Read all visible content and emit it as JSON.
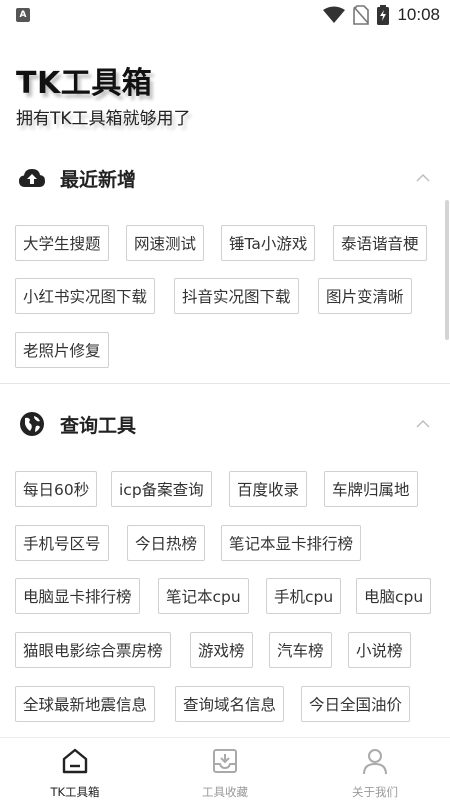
{
  "status_bar": {
    "notification_letter": "A",
    "time": "10:08"
  },
  "header": {
    "title": "TK工具箱",
    "subtitle": "拥有TK工具箱就够用了"
  },
  "sections": {
    "recent": {
      "title": "最近新增",
      "icon": "cloud-upload-icon",
      "items": [
        "大学生搜题",
        "网速测试",
        "锤Ta小游戏",
        "泰语谐音梗",
        "小红书实况图下载",
        "抖音实况图下载",
        "图片变清晰",
        "老照片修复"
      ]
    },
    "query": {
      "title": "查询工具",
      "icon": "globe-icon",
      "items": [
        "每日60秒",
        "icp备案查询",
        "百度收录",
        "车牌归属地",
        "手机号区号",
        "今日热榜",
        "笔记本显卡排行榜",
        "电脑显卡排行榜",
        "笔记本cpu",
        "手机cpu",
        "电脑cpu",
        "猫眼电影综合票房榜",
        "游戏榜",
        "汽车榜",
        "小说榜",
        "全球最新地震信息",
        "查询域名信息",
        "今日全国油价"
      ]
    }
  },
  "bottom_nav": [
    {
      "label": "TK工具箱",
      "icon": "home-icon",
      "active": true
    },
    {
      "label": "工具收藏",
      "icon": "archive-icon",
      "active": false
    },
    {
      "label": "关于我们",
      "icon": "person-icon",
      "active": false
    }
  ],
  "colors": {
    "active": "#222222",
    "inactive": "#9a9a9a",
    "chip_border": "#d0d0d0"
  }
}
